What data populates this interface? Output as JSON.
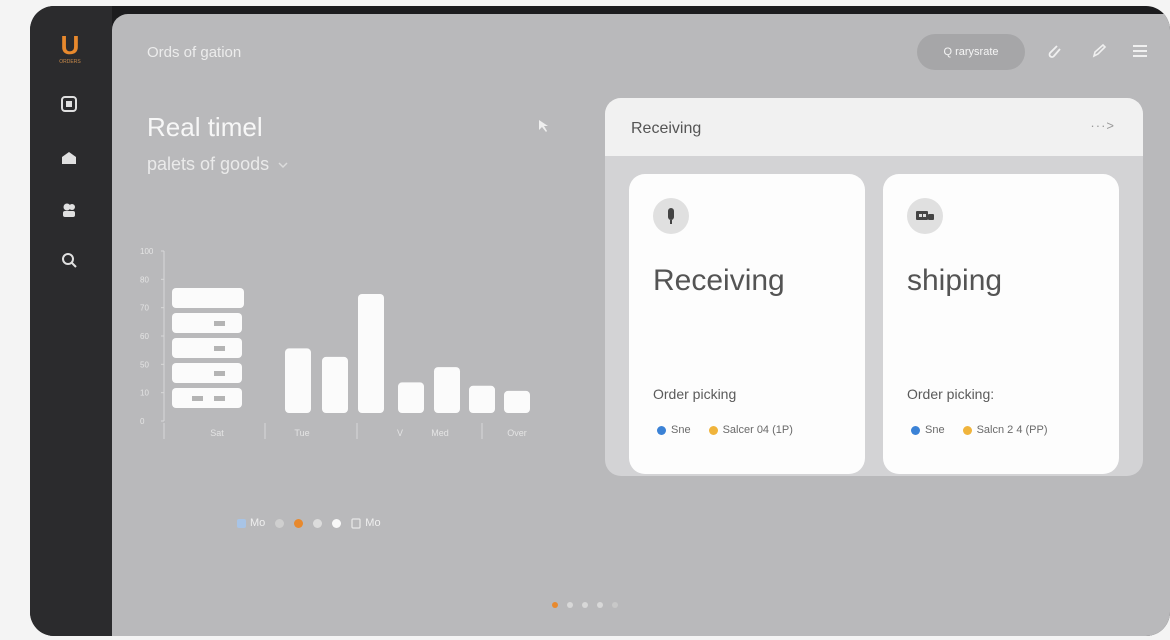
{
  "app": {
    "title": "Ords of gation"
  },
  "header": {
    "search_label": "Q rarysrate"
  },
  "hero": {
    "title": "Real timel",
    "subtitle": "palets of goods"
  },
  "colors": {
    "accent": "#e8892d",
    "blue": "#3b82d6",
    "yellow": "#f0b43c"
  },
  "chart_data": {
    "type": "bar",
    "y_ticks": [
      "100",
      "80",
      "70",
      "60",
      "50",
      "10",
      "0"
    ],
    "categories": [
      "Sat",
      "Tue",
      "V",
      "Med",
      "Over"
    ],
    "values": [
      38,
      33,
      70,
      18,
      27,
      16,
      13
    ],
    "stack_rows": 5
  },
  "legend": {
    "first": "Mo",
    "last": "Mo"
  },
  "panel": {
    "title": "Receiving",
    "more": "···>",
    "cards": [
      {
        "title": "Receiving",
        "subtitle": "Order picking",
        "tag1": "Sne",
        "tag2": "Salcer 04 (1P)"
      },
      {
        "title": "shiping",
        "subtitle": "Order picking:",
        "tag1": "Sne",
        "tag2": "Salcn 2 4 (PP)"
      }
    ]
  }
}
